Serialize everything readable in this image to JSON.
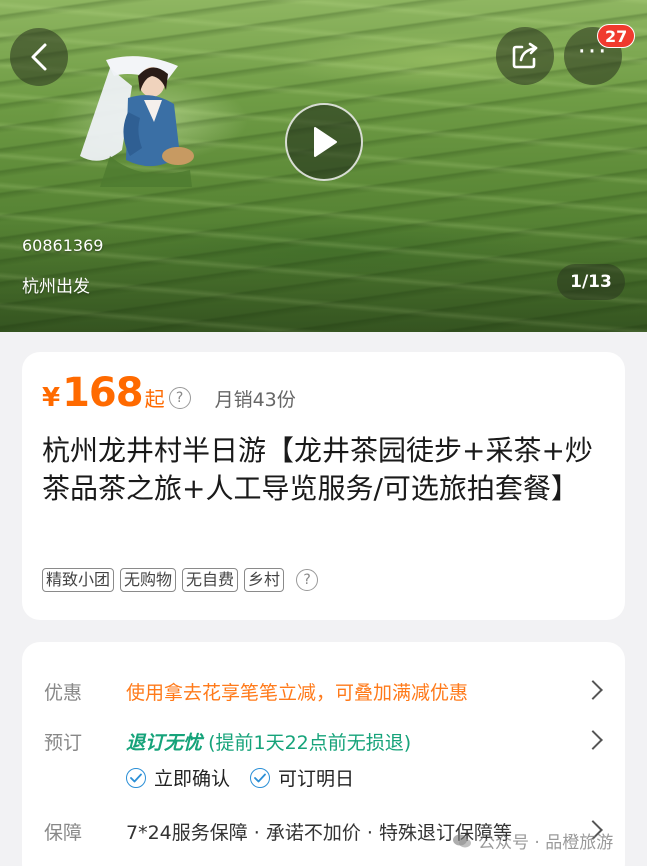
{
  "hero": {
    "product_code": "60861369",
    "departure": "杭州出发",
    "image_counter": "1/13",
    "notification_count": "27",
    "icons": [
      "back-arrow-icon",
      "share-icon",
      "more-icon",
      "play-icon"
    ]
  },
  "product": {
    "currency": "¥",
    "price": "168",
    "price_suffix": "起",
    "monthly_sales": "月销43份",
    "title": "杭州龙井村半日游【龙井茶园徒步+采茶+炒茶品茶之旅+人工导览服务/可选旅拍套餐】",
    "tags": [
      "精致小团",
      "无购物",
      "无自费",
      "乡村"
    ],
    "help_glyph": "?"
  },
  "info": {
    "discount_label": "优惠",
    "discount_text": "使用拿去花享笔笔立减，可叠加满减优惠",
    "booking_label": "预订",
    "booking_highlight": "退订无忧",
    "booking_detail": "(提前1天22点前无损退)",
    "confirm_instant": "立即确认",
    "book_tomorrow": "可订明日",
    "guarantee_label": "保障",
    "guarantee_text": "7*24服务保障 · 承诺不加价 · 特殊退订保障等"
  },
  "watermark": "公众号 · 品橙旅游",
  "colors": {
    "price": "#ff6a00",
    "discount": "#ff7a1a",
    "green": "#16a37a",
    "badge": "#f03a2e",
    "check": "#2b8fd6"
  }
}
